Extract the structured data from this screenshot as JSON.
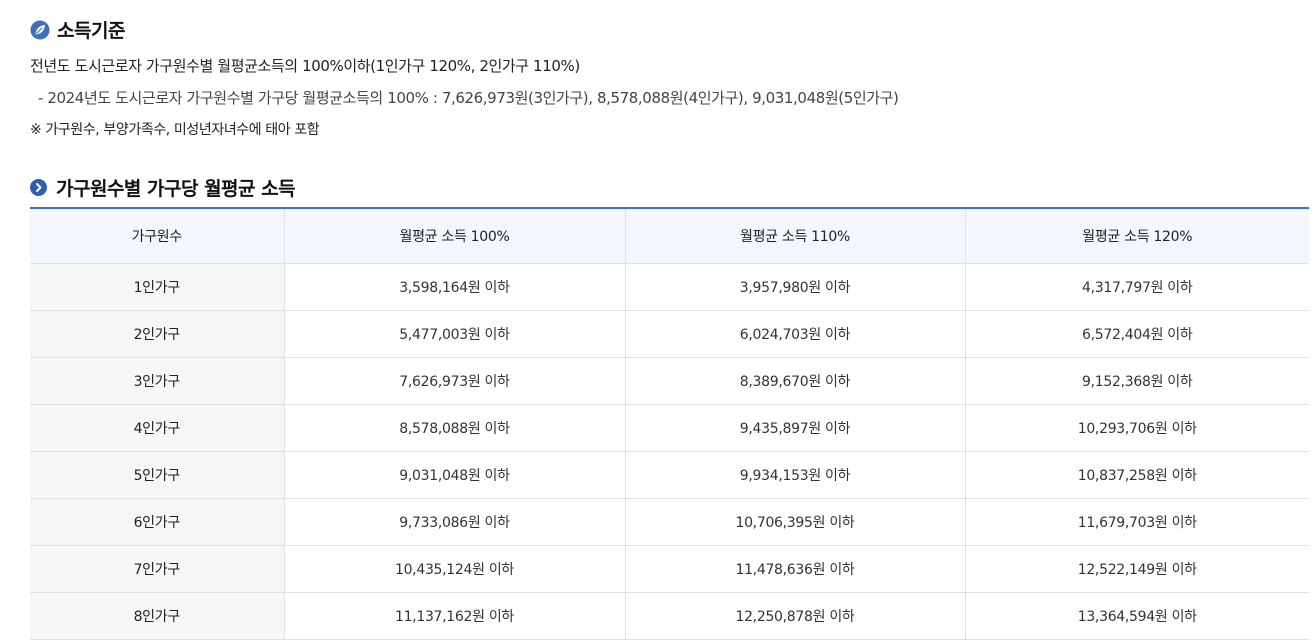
{
  "section1": {
    "title": "소득기준",
    "line1": "전년도 도시근로자 가구원수별 월평균소득의 100%이하(1인가구 120%, 2인가구 110%)",
    "line2": "- 2024년도 도시근로자 가구원수별 가구당 월평균소득의 100% : 7,626,973원(3인가구), 8,578,088원(4인가구), 9,031,048원(5인가구)",
    "note": "※ 가구원수, 부양가족수, 미성년자녀수에 태아 포함"
  },
  "section2": {
    "title": "가구원수별 가구당 월평균 소득"
  },
  "table": {
    "headers": [
      "가구원수",
      "월평균 소득 100%",
      "월평균 소득 110%",
      "월평균 소득 120%"
    ],
    "rows": [
      [
        "1인가구",
        "3,598,164원 이하",
        "3,957,980원 이하",
        "4,317,797원 이하"
      ],
      [
        "2인가구",
        "5,477,003원 이하",
        "6,024,703원 이하",
        "6,572,404원 이하"
      ],
      [
        "3인가구",
        "7,626,973원 이하",
        "8,389,670원 이하",
        "9,152,368원 이하"
      ],
      [
        "4인가구",
        "8,578,088원 이하",
        "9,435,897원 이하",
        "10,293,706원 이하"
      ],
      [
        "5인가구",
        "9,031,048원 이하",
        "9,934,153원 이하",
        "10,837,258원 이하"
      ],
      [
        "6인가구",
        "9,733,086원 이하",
        "10,706,395원 이하",
        "11,679,703원 이하"
      ],
      [
        "7인가구",
        "10,435,124원 이하",
        "11,478,636원 이하",
        "12,522,149원 이하"
      ],
      [
        "8인가구",
        "11,137,162원 이하",
        "12,250,878원 이하",
        "13,364,594원 이하"
      ]
    ]
  },
  "colors": {
    "accent": "#3e6fbf",
    "header_bg": "#f2f7fd",
    "row_label_bg": "#f6f6f6"
  },
  "icons": {
    "section1": "leaf-icon",
    "section2": "circle-arrow-icon"
  }
}
